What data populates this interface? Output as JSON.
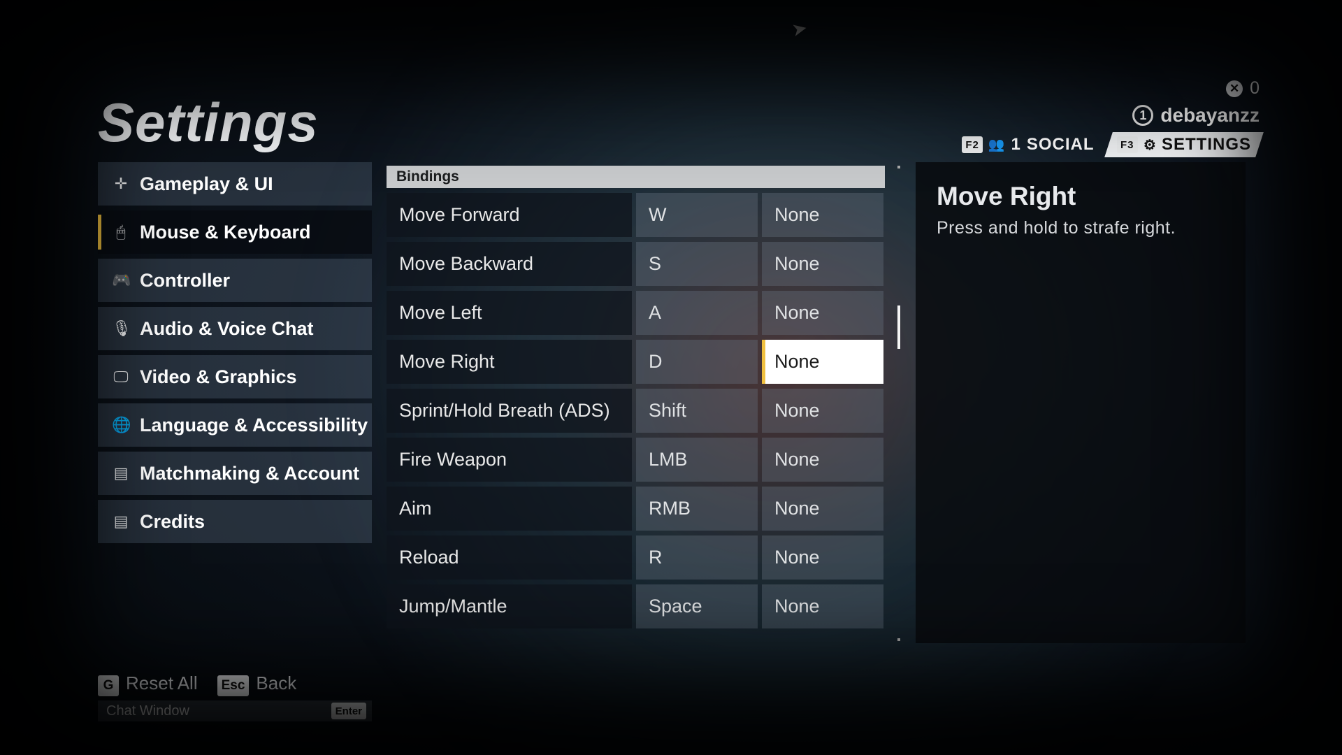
{
  "page_title": "Settings",
  "hud": {
    "currency_value": "0",
    "party_number": "1",
    "username": "debayanzz",
    "social_key": "F2",
    "social_count": "1",
    "social_label": "SOCIAL",
    "settings_key": "F3",
    "settings_label": "SETTINGS"
  },
  "sidebar": {
    "items": [
      {
        "label": "Gameplay & UI",
        "icon": "✛"
      },
      {
        "label": "Mouse & Keyboard",
        "icon": "🖱"
      },
      {
        "label": "Controller",
        "icon": "🎮"
      },
      {
        "label": "Audio & Voice Chat",
        "icon": "🎙"
      },
      {
        "label": "Video & Graphics",
        "icon": "🖵"
      },
      {
        "label": "Language & Accessibility",
        "icon": "🌐"
      },
      {
        "label": "Matchmaking & Account",
        "icon": "▤"
      },
      {
        "label": "Credits",
        "icon": "▤"
      }
    ],
    "active_index": 1
  },
  "bindings_header": "Bindings",
  "bindings": [
    {
      "label": "Move Forward",
      "primary": "W",
      "alt": "None"
    },
    {
      "label": "Move Backward",
      "primary": "S",
      "alt": "None"
    },
    {
      "label": "Move Left",
      "primary": "A",
      "alt": "None"
    },
    {
      "label": "Move Right",
      "primary": "D",
      "alt": "None"
    },
    {
      "label": "Sprint/Hold Breath (ADS)",
      "primary": "Shift",
      "alt": "None"
    },
    {
      "label": "Fire Weapon",
      "primary": "LMB",
      "alt": "None"
    },
    {
      "label": "Aim",
      "primary": "RMB",
      "alt": "None"
    },
    {
      "label": "Reload",
      "primary": "R",
      "alt": "None"
    },
    {
      "label": "Jump/Mantle",
      "primary": "Space",
      "alt": "None"
    }
  ],
  "selected_binding_index": 3,
  "detail": {
    "title": "Move Right",
    "description": "Press and hold to strafe right."
  },
  "footer": {
    "reset_key": "G",
    "reset_label": "Reset All",
    "back_key": "Esc",
    "back_label": "Back"
  },
  "chat": {
    "label": "Chat Window",
    "key": "Enter"
  }
}
